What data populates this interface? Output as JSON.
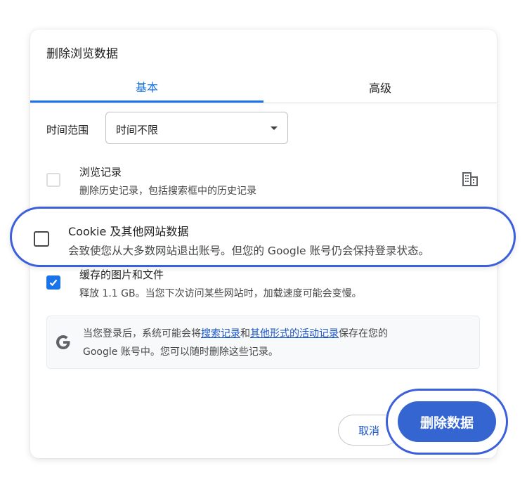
{
  "dialog": {
    "title": "删除浏览数据"
  },
  "tabs": [
    {
      "label": "基本",
      "selected": true
    },
    {
      "label": "高级",
      "selected": false
    }
  ],
  "time_range": {
    "label": "时间范围",
    "value": "时间不限"
  },
  "items": {
    "history": {
      "title": "浏览记录",
      "desc": "删除历史记录，包括搜索框中的历史记录",
      "checked": false
    },
    "cookies": {
      "title": "Cookie 及其他网站数据",
      "desc": "会致使您从大多数网站退出账号。但您的 Google 账号仍会保持登录状态。",
      "checked": false
    },
    "cache": {
      "title": "缓存的图片和文件",
      "desc": "释放 1.1 GB。当您下次访问某些网站时，加载速度可能会变慢。",
      "checked": true
    }
  },
  "info": {
    "text_1": "当您登录后，系统可能会将",
    "link_1": "搜索记录",
    "text_2": "和",
    "link_2": "其他形式的活动记录",
    "text_3": "保存在您的",
    "text_4": "Google 账号中。您可以随时删除这些记录。"
  },
  "buttons": {
    "cancel": "取消",
    "delete": "删除数据"
  },
  "colors": {
    "accent": "#1a73e8",
    "highlight": "#3c5fdc",
    "primary_button": "#3565d0"
  },
  "icons": {
    "managed": "building-icon",
    "google": "google-g-icon",
    "dropdown": "caret-down-icon",
    "check": "checkmark-icon"
  }
}
